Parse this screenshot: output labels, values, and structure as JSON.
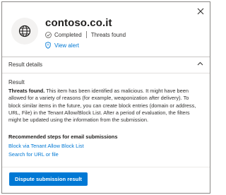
{
  "header": {
    "title": "contoso.co.it",
    "status": "Completed",
    "result_badge": "Threats found",
    "view_alert_label": "View alert"
  },
  "section": {
    "label": "Result details"
  },
  "result": {
    "heading": "Result",
    "lead": "Threats found.",
    "body": " This item has been identified as malicious. It might have been allowed for a variety of reasons (for example, weaponization after delivery). To block similar items in the future, you can create block entries (domain or address, URL, File) in the Tenant Allow/Block List. After a period of evaluation, the filters might be updated using the information from the submission."
  },
  "recommendations": {
    "title": "Recommended steps for email submissions",
    "links": [
      "Block via Tenant Allow Block List",
      "Search for URL or file"
    ]
  },
  "actions": {
    "dispute_label": "Dispute submission result"
  },
  "icons": {
    "close": "close-icon",
    "globe": "globe-icon",
    "check": "checkmark-icon",
    "shield": "shield-icon",
    "chevron": "chevron-up-icon"
  },
  "colors": {
    "accent": "#0078d4",
    "text": "#323130",
    "border": "#8a8886"
  }
}
